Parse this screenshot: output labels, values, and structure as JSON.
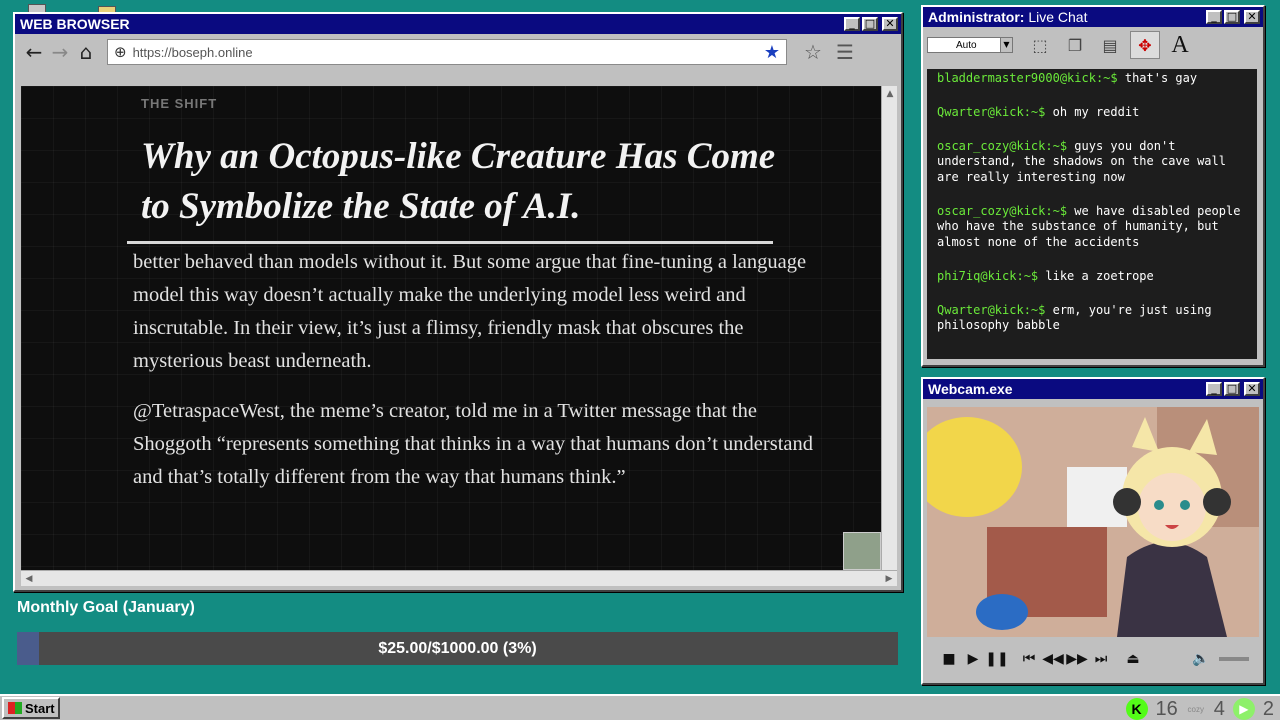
{
  "browser": {
    "title": "WEB BROWSER",
    "url": "https://boseph.online",
    "icons": {
      "back": "arrow-left-icon",
      "forward": "arrow-right-icon",
      "home": "home-icon",
      "bookmark": "star-filled-icon",
      "favorite": "star-outline-icon",
      "menu": "hamburger-icon"
    }
  },
  "article": {
    "kicker": "THE SHIFT",
    "headline": "Why an Octopus-like Creature Has Come to Symbolize the State of A.I.",
    "paragraphs": [
      "better behaved than models without it. But some argue that fine-tuning a language model this way doesn’t actually make the underlying model less weird and inscrutable. In their view, it’s just a flimsy, friendly mask that obscures the mysterious beast underneath.",
      "@TetraspaceWest, the meme’s creator, told me in a Twitter message that the Shoggoth “represents something that thinks in a way that humans don’t understand and that’s totally different from the way that humans think.”"
    ]
  },
  "goal": {
    "title": "Monthly Goal (January)",
    "text": "$25.00/$1000.00 (3%)",
    "progress_percent": 2.5,
    "fill_color": "#4a5c8c"
  },
  "chat": {
    "title_bold": "Administrator:",
    "title_rest": " Live Chat",
    "font_select": "Auto",
    "messages": [
      {
        "user": "bladdermaster9000@kick:~$",
        "text": " that's gay"
      },
      {
        "user": "Qwarter@kick:~$",
        "text": " oh my reddit"
      },
      {
        "user": "oscar_cozy@kick:~$",
        "text": " guys you don't understand, the shadows on the cave wall are really interesting now"
      },
      {
        "user": "oscar_cozy@kick:~$",
        "text": " we have disabled people who have the substance of humanity, but almost none of the accidents"
      },
      {
        "user": "phi7iq@kick:~$",
        "text": " like a zoetrope"
      },
      {
        "user": "Qwarter@kick:~$",
        "text": " erm, you're just using philosophy babble"
      }
    ],
    "user_color": "#6bea3a"
  },
  "webcam": {
    "title": "Webcam.exe"
  },
  "taskbar": {
    "start": "Start",
    "stat1": "16",
    "cozy_label": "cozy",
    "stat2": "4",
    "stat3": "2",
    "kick_glyph": "K"
  }
}
